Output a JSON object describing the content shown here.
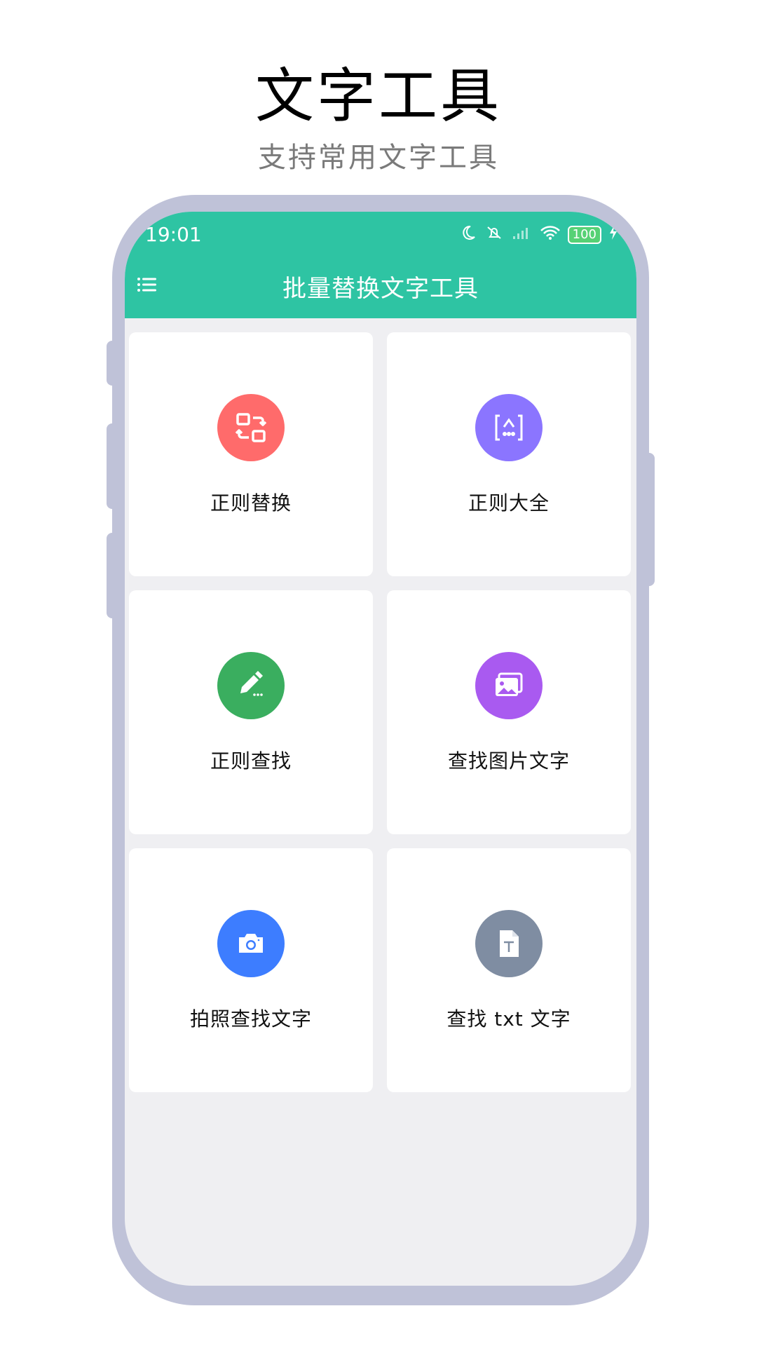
{
  "promo": {
    "title": "文字工具",
    "subtitle": "支持常用文字工具"
  },
  "status_bar": {
    "time": "19:01",
    "battery": "100",
    "icons": [
      "moon-icon",
      "mute-icon",
      "signal-icon",
      "wifi-icon",
      "battery-icon",
      "charging-icon"
    ]
  },
  "app_bar": {
    "title": "批量替换文字工具",
    "menu_icon": "menu-icon"
  },
  "cards": [
    {
      "label": "正则替换",
      "icon": "swap-icon",
      "color": "#ff6b6b"
    },
    {
      "label": "正则大全",
      "icon": "regex-icon",
      "color": "#8b75ff"
    },
    {
      "label": "正则查找",
      "icon": "edit-icon",
      "color": "#3aae5f"
    },
    {
      "label": "查找图片文字",
      "icon": "image-icon",
      "color": "#a95af0"
    },
    {
      "label": "拍照查找文字",
      "icon": "camera-icon",
      "color": "#3d7dff"
    },
    {
      "label": "查找 txt 文字",
      "icon": "text-file-icon",
      "color": "#7f8da2"
    }
  ],
  "colors": {
    "header": "#2ec4a3",
    "frame": "#bfc2d8",
    "screen_bg": "#efeff2"
  }
}
